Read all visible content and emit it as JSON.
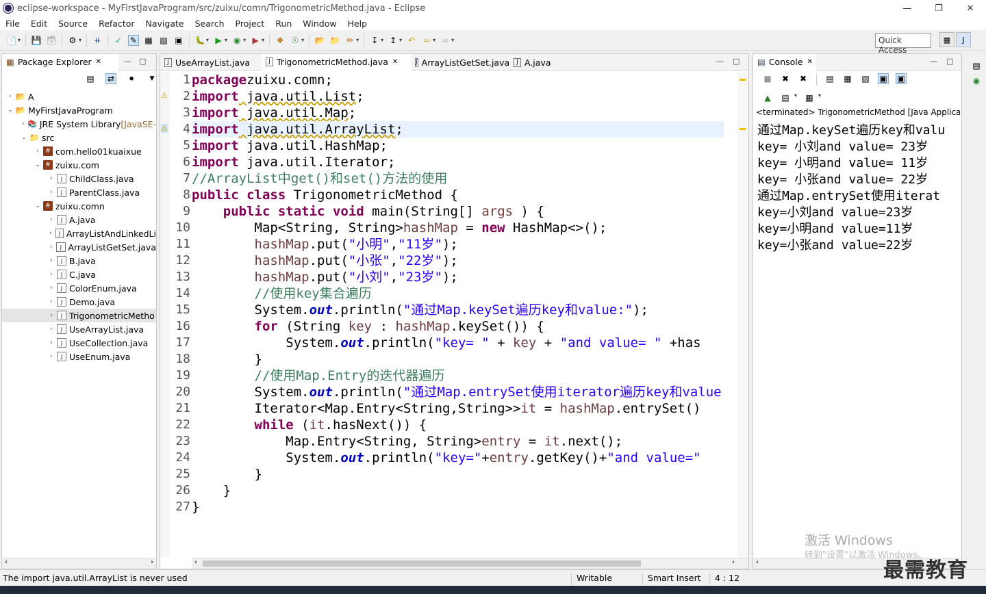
{
  "window": {
    "title": "eclipse-workspace - MyFirstJavaProgram/src/zuixu/comn/TrigonometricMethod.java - Eclipse"
  },
  "menu": [
    "File",
    "Edit",
    "Source",
    "Refactor",
    "Navigate",
    "Search",
    "Project",
    "Run",
    "Window",
    "Help"
  ],
  "quick_access": "Quick Access",
  "explorer": {
    "title": "Package Explorer",
    "items": [
      {
        "label": "A",
        "depth": 0,
        "arrow": "›",
        "icon": "project"
      },
      {
        "label": "MyFirstJavaProgram",
        "depth": 0,
        "arrow": "⌄",
        "icon": "project"
      },
      {
        "label": "JRE System Library",
        "extra": "[JavaSE-",
        "depth": 1,
        "arrow": "›",
        "icon": "library"
      },
      {
        "label": "src",
        "depth": 1,
        "arrow": "⌄",
        "icon": "folder"
      },
      {
        "label": "com.hello01kuaixue",
        "depth": 2,
        "arrow": "›",
        "icon": "package"
      },
      {
        "label": "zuixu.com",
        "depth": 2,
        "arrow": "⌄",
        "icon": "package"
      },
      {
        "label": "ChildClass.java",
        "depth": 3,
        "arrow": "›",
        "icon": "file"
      },
      {
        "label": "ParentClass.java",
        "depth": 3,
        "arrow": "›",
        "icon": "file"
      },
      {
        "label": "zuixu.comn",
        "depth": 2,
        "arrow": "⌄",
        "icon": "package"
      },
      {
        "label": "A.java",
        "depth": 3,
        "arrow": "›",
        "icon": "file"
      },
      {
        "label": "ArrayListAndLinkedLi",
        "depth": 3,
        "arrow": "›",
        "icon": "file"
      },
      {
        "label": "ArrayListGetSet.java",
        "depth": 3,
        "arrow": "›",
        "icon": "file"
      },
      {
        "label": "B.java",
        "depth": 3,
        "arrow": "›",
        "icon": "file"
      },
      {
        "label": "C.java",
        "depth": 3,
        "arrow": "›",
        "icon": "file"
      },
      {
        "label": "ColorEnum.java",
        "depth": 3,
        "arrow": "›",
        "icon": "file"
      },
      {
        "label": "Demo.java",
        "depth": 3,
        "arrow": "›",
        "icon": "file"
      },
      {
        "label": "TrigonometricMetho",
        "depth": 3,
        "arrow": "›",
        "icon": "file",
        "selected": true
      },
      {
        "label": "UseArrayList.java",
        "depth": 3,
        "arrow": "›",
        "icon": "file"
      },
      {
        "label": "UseCollection.java",
        "depth": 3,
        "arrow": "›",
        "icon": "file"
      },
      {
        "label": "UseEnum.java",
        "depth": 3,
        "arrow": "›",
        "icon": "file"
      }
    ]
  },
  "editor": {
    "tabs": [
      {
        "label": "UseArrayList.java",
        "active": false
      },
      {
        "label": "TrigonometricMethod.java",
        "active": true
      },
      {
        "label": "ArrayListGetSet.java",
        "active": false
      },
      {
        "label": "A.java",
        "active": false
      }
    ],
    "line_numbers": [
      "1",
      "2",
      "3",
      "4",
      "5",
      "6",
      "7",
      "8",
      "9",
      "10",
      "11",
      "12",
      "13",
      "14",
      "15",
      "16",
      "17",
      "18",
      "19",
      "20",
      "21",
      "22",
      "23",
      "24",
      "25",
      "26",
      "27"
    ],
    "lines": [
      [
        [
          "kw",
          "package"
        ],
        [
          "",
          "zuixu.comn;"
        ]
      ],
      [
        [
          "kw",
          "import"
        ],
        [
          "wu",
          " java.util.List"
        ],
        [
          "",
          ";"
        ]
      ],
      [
        [
          "kw",
          "import"
        ],
        [
          "wu",
          " java.util.Map"
        ],
        [
          "",
          ";"
        ]
      ],
      [
        [
          "kw",
          "import"
        ],
        [
          "wu",
          " java.util.ArrayList"
        ],
        [
          "",
          ";"
        ]
      ],
      [
        [
          "kw",
          "import"
        ],
        [
          "",
          " java.util.HashMap;"
        ]
      ],
      [
        [
          "kw",
          "import"
        ],
        [
          "",
          " java.util.Iterator;"
        ]
      ],
      [
        [
          "cm",
          "//ArrayList中get()和set()方法的使用"
        ]
      ],
      [
        [
          "kw",
          "public"
        ],
        [
          "",
          " "
        ],
        [
          "kw",
          "class"
        ],
        [
          "",
          " TrigonometricMethod {"
        ]
      ],
      [
        [
          "",
          "    "
        ],
        [
          "kw",
          "public"
        ],
        [
          "",
          " "
        ],
        [
          "kw",
          "static"
        ],
        [
          "",
          " "
        ],
        [
          "kw",
          "void"
        ],
        [
          "",
          " main(String[] "
        ],
        [
          "vr",
          "args"
        ],
        [
          "",
          " ) {"
        ]
      ],
      [
        [
          "",
          "        Map<String, String>"
        ],
        [
          "vr",
          "hashMap"
        ],
        [
          "",
          " = "
        ],
        [
          "kw",
          "new"
        ],
        [
          "",
          " HashMap<>();"
        ]
      ],
      [
        [
          "",
          "        "
        ],
        [
          "vr",
          "hashMap"
        ],
        [
          "",
          ".put("
        ],
        [
          "st",
          "\"小明\""
        ],
        [
          "",
          ","
        ],
        [
          "st",
          "\"11岁\""
        ],
        [
          "",
          ");"
        ]
      ],
      [
        [
          "",
          "        "
        ],
        [
          "vr",
          "hashMap"
        ],
        [
          "",
          ".put("
        ],
        [
          "st",
          "\"小张\""
        ],
        [
          "",
          ","
        ],
        [
          "st",
          "\"22岁\""
        ],
        [
          "",
          ");"
        ]
      ],
      [
        [
          "",
          "        "
        ],
        [
          "vr",
          "hashMap"
        ],
        [
          "",
          ".put("
        ],
        [
          "st",
          "\"小刘\""
        ],
        [
          "",
          ","
        ],
        [
          "st",
          "\"23岁\""
        ],
        [
          "",
          ");"
        ]
      ],
      [
        [
          "",
          "        "
        ],
        [
          "cm",
          "//使用key集合遍历"
        ]
      ],
      [
        [
          "",
          "        System."
        ],
        [
          "fd",
          "out"
        ],
        [
          "",
          ".println("
        ],
        [
          "st",
          "\"通过Map.keySet遍历key和value:\""
        ],
        [
          "",
          ");"
        ]
      ],
      [
        [
          "",
          "        "
        ],
        [
          "kw",
          "for"
        ],
        [
          "",
          " (String "
        ],
        [
          "vr",
          "key"
        ],
        [
          "",
          " : "
        ],
        [
          "vr",
          "hashMap"
        ],
        [
          "",
          ".keySet()) {"
        ]
      ],
      [
        [
          "",
          "            System."
        ],
        [
          "fd",
          "out"
        ],
        [
          "",
          ".println("
        ],
        [
          "st",
          "\"key= \""
        ],
        [
          "",
          " + "
        ],
        [
          "vr",
          "key"
        ],
        [
          "",
          " + "
        ],
        [
          "st",
          "\"and value= \""
        ],
        [
          "",
          " +has"
        ]
      ],
      [
        [
          "",
          "        }"
        ]
      ],
      [
        [
          "",
          "        "
        ],
        [
          "cm",
          "//使用Map.Entry的迭代器遍历"
        ]
      ],
      [
        [
          "",
          "        System."
        ],
        [
          "fd",
          "out"
        ],
        [
          "",
          ".println("
        ],
        [
          "st",
          "\"通过Map.entrySet使用iterator遍历key和value"
        ]
      ],
      [
        [
          "",
          "        Iterator<Map.Entry<String,String>>"
        ],
        [
          "vr",
          "it"
        ],
        [
          "",
          " = "
        ],
        [
          "vr",
          "hashMap"
        ],
        [
          "",
          ".entrySet()"
        ]
      ],
      [
        [
          "",
          "        "
        ],
        [
          "kw",
          "while"
        ],
        [
          "",
          " ("
        ],
        [
          "vr",
          "it"
        ],
        [
          "",
          ".hasNext()) {"
        ]
      ],
      [
        [
          "",
          "            Map.Entry<String, String>"
        ],
        [
          "vr",
          "entry"
        ],
        [
          "",
          " = "
        ],
        [
          "vr",
          "it"
        ],
        [
          "",
          ".next();"
        ]
      ],
      [
        [
          "",
          "            System."
        ],
        [
          "fd",
          "out"
        ],
        [
          "",
          ".println("
        ],
        [
          "st",
          "\"key=\""
        ],
        [
          "",
          "+"
        ],
        [
          "vr",
          "entry"
        ],
        [
          "",
          ".getKey()+"
        ],
        [
          "st",
          "\"and value=\""
        ]
      ],
      [
        [
          "",
          "        }"
        ]
      ],
      [
        [
          "",
          "    }"
        ]
      ],
      [
        [
          "",
          "}"
        ]
      ]
    ],
    "current_line": 4
  },
  "console": {
    "title": "Console",
    "header": "<terminated> TrigonometricMethod [Java Applicati",
    "lines": [
      "通过Map.keySet遍历key和valu",
      "key= 小刘and value= 23岁",
      "key= 小明and value= 11岁",
      "key= 小张and value= 22岁",
      "通过Map.entrySet使用iterat",
      "key=小刘and value=23岁",
      "key=小明and value=11岁",
      "key=小张and value=22岁"
    ]
  },
  "status": {
    "message": "The import java.util.ArrayList is never used",
    "writable": "Writable",
    "insert_mode": "Smart Insert",
    "position": "4 : 12"
  },
  "watermark": {
    "line1": "激活 Windows",
    "line2": "转到\"设置\"以激活 Windows。"
  },
  "brand": "最需教育"
}
